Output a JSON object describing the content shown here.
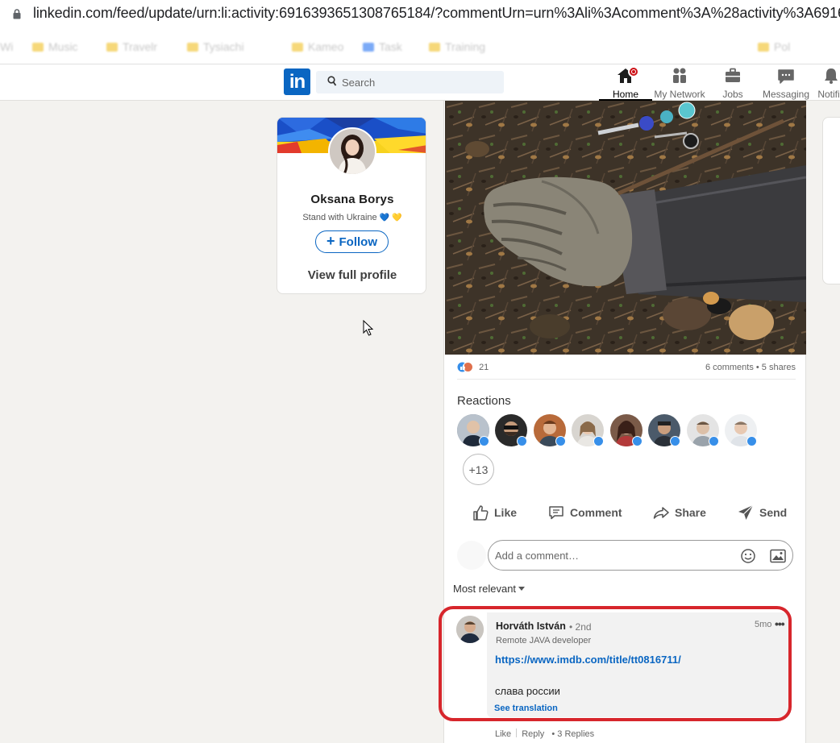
{
  "browser": {
    "url": "linkedin.com/feed/update/urn:li:activity:6916393651308765184/?commentUrn=urn%3Ali%3Acomment%3A%28activity%3A6916393",
    "bookmarks": [
      "Wi",
      "Music",
      "Travelr",
      "Tysiachi",
      "Kameo",
      "Task",
      "Training",
      "Pol"
    ]
  },
  "nav": {
    "search_placeholder": "Search",
    "items": {
      "home": "Home",
      "network": "My Network",
      "jobs": "Jobs",
      "messaging": "Messaging",
      "notifications": "Notific"
    }
  },
  "profile": {
    "name": "Oksana Borys",
    "headline": "Stand with Ukraine",
    "hearts": [
      "💙",
      "💛"
    ],
    "follow_label": "Follow",
    "view_profile_label": "View full profile"
  },
  "post": {
    "reaction_count": "21",
    "comments_shares": "6 comments • 5 shares",
    "reactions_title": "Reactions",
    "more_reactions": "+13",
    "actions": {
      "like": "Like",
      "comment": "Comment",
      "share": "Share",
      "send": "Send"
    },
    "comment_placeholder": "Add a comment…",
    "sort_label": "Most relevant"
  },
  "comment": {
    "author": "Horváth István",
    "degree": "• 2nd",
    "headline": "Remote JAVA developer",
    "time": "5mo",
    "link": "https://www.imdb.com/title/tt0816711/",
    "text": "слава россии",
    "see_translation": "See translation",
    "actions": {
      "like": "Like",
      "reply": "Reply",
      "replies": "3 Replies"
    }
  },
  "colors": {
    "brand": "#0a66c2",
    "highlight": "#d7262c",
    "background": "#f3f2ef"
  }
}
